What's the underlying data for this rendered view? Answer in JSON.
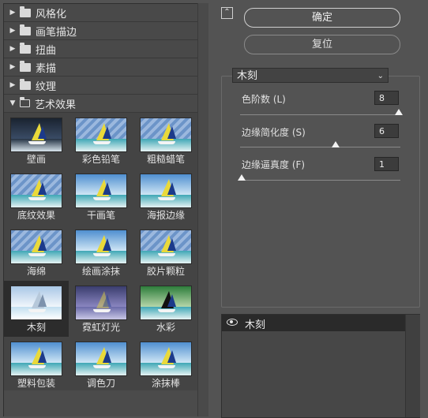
{
  "categories": [
    {
      "label": "风格化"
    },
    {
      "label": "画笔描边"
    },
    {
      "label": "扭曲"
    },
    {
      "label": "素描"
    },
    {
      "label": "纹理"
    },
    {
      "label": "艺术效果"
    }
  ],
  "filters": [
    {
      "label": "壁画"
    },
    {
      "label": "彩色铅笔"
    },
    {
      "label": "粗糙蜡笔"
    },
    {
      "label": "底纹效果"
    },
    {
      "label": "干画笔"
    },
    {
      "label": "海报边缘"
    },
    {
      "label": "海绵"
    },
    {
      "label": "绘画涂抹"
    },
    {
      "label": "胶片颗粒"
    },
    {
      "label": "木刻"
    },
    {
      "label": "霓虹灯光"
    },
    {
      "label": "水彩"
    },
    {
      "label": "塑料包装"
    },
    {
      "label": "调色刀"
    },
    {
      "label": "涂抹棒"
    }
  ],
  "buttons": {
    "ok": "确定",
    "reset": "复位"
  },
  "settings": {
    "selected_filter": "木刻",
    "params": [
      {
        "label": "色阶数 (L)",
        "value": "8",
        "level": 1.0
      },
      {
        "label": "边缘简化度 (S)",
        "value": "6",
        "level": 0.6
      },
      {
        "label": "边缘逼真度 (F)",
        "value": "1",
        "level": 0.0
      }
    ]
  },
  "effect_layers": [
    {
      "name": "木刻",
      "visible": true
    }
  ],
  "icons": {
    "preview_toggle": "collapse-up-icon",
    "visibility": "eye-icon",
    "category": "folder-icon"
  },
  "colors": {
    "background": "#535353",
    "panel": "#444444",
    "selected": "#2c2c2c"
  }
}
